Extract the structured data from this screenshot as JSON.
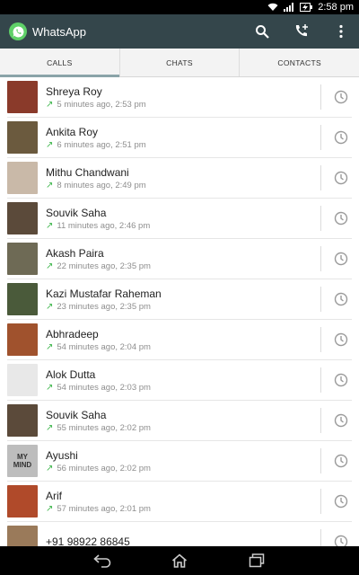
{
  "status": {
    "time": "2:58 pm"
  },
  "app": {
    "title": "WhatsApp"
  },
  "tabs": [
    {
      "label": "CALLS",
      "active": true
    },
    {
      "label": "CHATS",
      "active": false
    },
    {
      "label": "CONTACTS",
      "active": false
    }
  ],
  "calls": [
    {
      "name": "Shreya Roy",
      "meta": "5 minutes ago, 2:53 pm",
      "avatar_color": "#8a3a2a"
    },
    {
      "name": "Ankita Roy",
      "meta": "6 minutes ago, 2:51 pm",
      "avatar_color": "#6b5a3e"
    },
    {
      "name": "Mithu Chandwani",
      "meta": "8 minutes ago, 2:49 pm",
      "avatar_color": "#c9b9a8"
    },
    {
      "name": "Souvik Saha",
      "meta": "11 minutes ago, 2:46 pm",
      "avatar_color": "#5b4a3a"
    },
    {
      "name": "Akash Paira",
      "meta": "22 minutes ago, 2:35 pm",
      "avatar_color": "#6e6a55"
    },
    {
      "name": "Kazi Mustafar Raheman",
      "meta": "23 minutes ago, 2:35 pm",
      "avatar_color": "#4a5a3a"
    },
    {
      "name": "Abhradeep",
      "meta": "54 minutes ago, 2:04 pm",
      "avatar_color": "#a0522d"
    },
    {
      "name": "Alok Dutta",
      "meta": "54 minutes ago, 2:03 pm",
      "avatar_color": "#e8e8e8"
    },
    {
      "name": "Souvik Saha",
      "meta": "55 minutes ago, 2:02 pm",
      "avatar_color": "#5b4a3a"
    },
    {
      "name": "Ayushi",
      "meta": "56 minutes ago, 2:02 pm",
      "avatar_color": "#bdbdbd",
      "avatar_text": "MY MIND"
    },
    {
      "name": "Arif",
      "meta": "57 minutes ago, 2:01 pm",
      "avatar_color": "#b04a2a"
    },
    {
      "name": "+91 98922 86845",
      "meta": "",
      "avatar_color": "#9a7a5a"
    }
  ],
  "colors": {
    "appbar": "#34464b",
    "accent_green": "#3cb54a",
    "logo_green": "#5fd068"
  },
  "icons": {
    "status": [
      "wifi-icon",
      "signal-icon",
      "battery-charging-icon"
    ],
    "appbar": [
      "search-icon",
      "add-call-icon",
      "overflow-menu-icon"
    ],
    "row": [
      "outgoing-call-arrow-icon",
      "call-history-clock-icon"
    ],
    "nav": [
      "back-icon",
      "home-icon",
      "recent-apps-icon"
    ]
  }
}
